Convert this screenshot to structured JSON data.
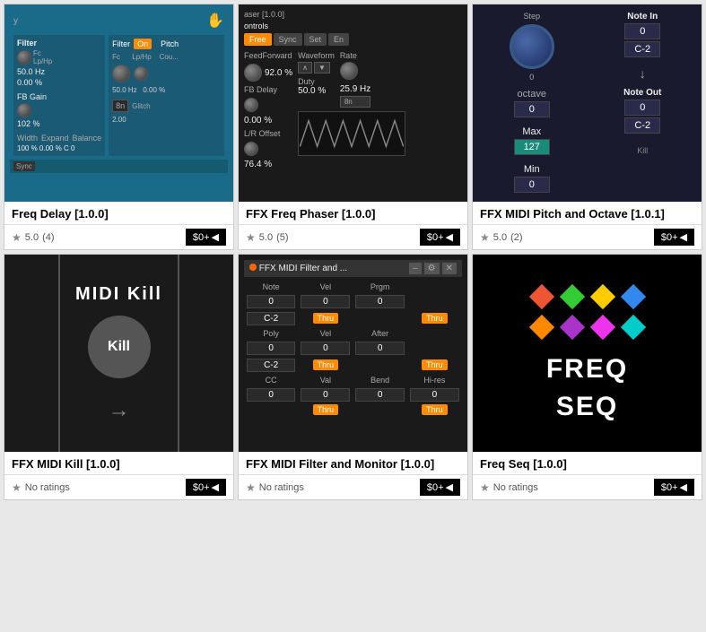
{
  "cards": [
    {
      "id": "freq-delay",
      "title": "Freq Delay [1.0.0]",
      "rating": "5.0",
      "rating_count": "(4)",
      "price": "$0+",
      "preview_type": "freq-delay"
    },
    {
      "id": "ffx-freq-phaser",
      "title": "FFX Freq Phaser [1.0.0]",
      "rating": "5.0",
      "rating_count": "(5)",
      "price": "$0+",
      "preview_type": "phaser"
    },
    {
      "id": "ffx-midi-pitch",
      "title": "FFX MIDI Pitch and Octave [1.0.1]",
      "rating": "5.0",
      "rating_count": "(2)",
      "price": "$0+",
      "preview_type": "pitch"
    },
    {
      "id": "ffx-midi-kill",
      "title": "FFX MIDI Kill [1.0.0]",
      "rating": "No ratings",
      "rating_count": "",
      "price": "$0+",
      "preview_type": "midi-kill"
    },
    {
      "id": "ffx-midi-filter",
      "title": "FFX MIDI Filter and Monitor [1.0.0]",
      "rating": "No ratings",
      "rating_count": "",
      "price": "$0+",
      "preview_type": "filter-monitor"
    },
    {
      "id": "freq-seq",
      "title": "Freq Seq [1.0.0]",
      "rating": "No ratings",
      "rating_count": "",
      "price": "$0+",
      "preview_type": "freqseq"
    }
  ],
  "labels": {
    "filter": "Filter",
    "on": "On",
    "pitch": "Pitch",
    "fc": "Fc",
    "lp_hp": "Lp/Hp",
    "fb_gain": "FB Gain",
    "width": "Width",
    "expand": "Expand",
    "balance": "Balance",
    "sync": "Sync",
    "feedforward": "FeedForward",
    "fb_delay": "FB Delay",
    "lr_offset": "L/R Offset",
    "waveform": "Waveform",
    "rate": "Rate",
    "duty": "Duty",
    "free": "Free",
    "sync_tab": "Sync",
    "set": "Set",
    "en": "En",
    "step": "Step",
    "octave": "octave",
    "max": "Max",
    "min": "Min",
    "note_in": "Note In",
    "note_out": "Note Out",
    "midi_kill": "MIDI Kill",
    "kill": "Kill",
    "note": "Note",
    "vel": "Vel",
    "prgm": "Prgm",
    "poly": "Poly",
    "after": "After",
    "cc": "CC",
    "val": "Val",
    "bend": "Bend",
    "hires": "Hi-res",
    "thru": "Thru",
    "freq_seq": "FREQ SEQ"
  }
}
